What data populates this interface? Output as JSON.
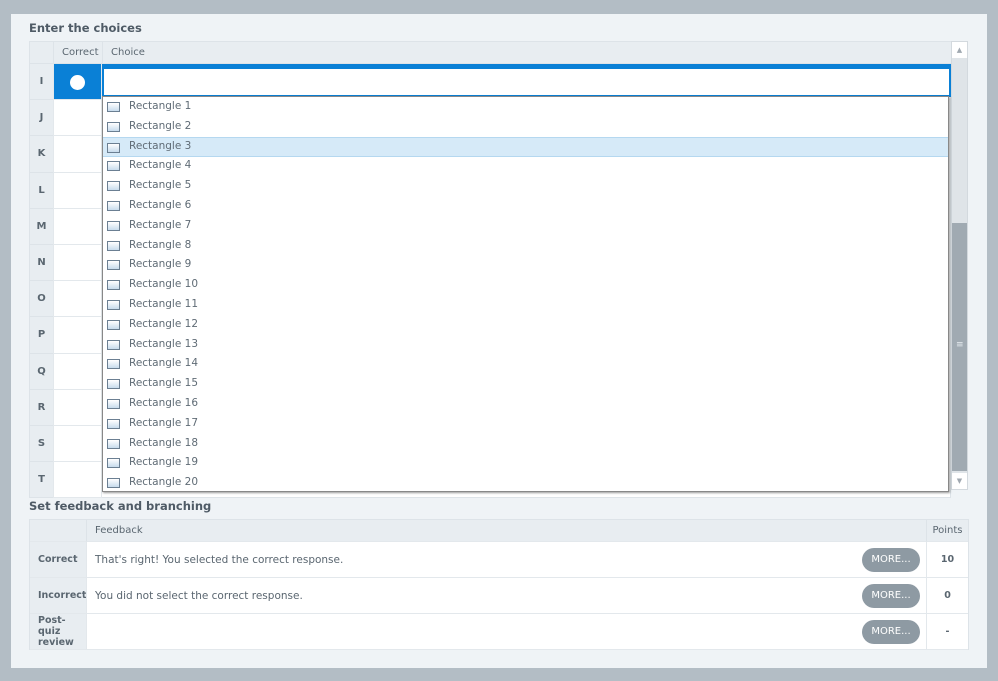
{
  "choices_section": {
    "title": "Enter the choices",
    "col_correct": "Correct",
    "col_choice": "Choice",
    "rows": [
      "I",
      "J",
      "K",
      "L",
      "M",
      "N",
      "O",
      "P",
      "Q",
      "R",
      "S",
      "T"
    ],
    "selected_row": "I",
    "choice_value": ""
  },
  "dropdown": {
    "items": [
      "Rectangle 1",
      "Rectangle 2",
      "Rectangle 3",
      "Rectangle 4",
      "Rectangle 5",
      "Rectangle 6",
      "Rectangle 7",
      "Rectangle 8",
      "Rectangle 9",
      "Rectangle 10",
      "Rectangle 11",
      "Rectangle 12",
      "Rectangle 13",
      "Rectangle 14",
      "Rectangle 15",
      "Rectangle 16",
      "Rectangle 17",
      "Rectangle 18",
      "Rectangle 19",
      "Rectangle 20"
    ],
    "highlighted_index": 2,
    "icon": "rectangle-shape-icon"
  },
  "feedback_section": {
    "title": "Set feedback and branching",
    "col_feedback": "Feedback",
    "col_points": "Points",
    "rows": [
      {
        "label": "Correct",
        "feedback": "That's right!  You selected the correct response.",
        "more": "MORE...",
        "points": "10"
      },
      {
        "label": "Incorrect",
        "feedback": "You did not select the correct response.",
        "more": "MORE...",
        "points": "0"
      },
      {
        "label": "Post-quiz review",
        "feedback": "",
        "more": "MORE...",
        "points": "-"
      }
    ]
  },
  "colors": {
    "accent": "#0a80d6",
    "highlight": "#d6eaf8",
    "button": "#8e9aa3"
  }
}
